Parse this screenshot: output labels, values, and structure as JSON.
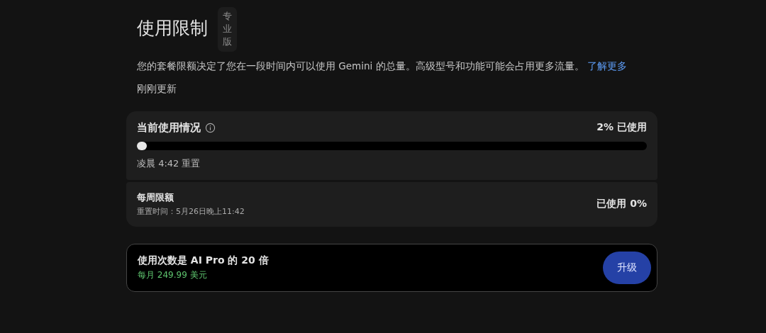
{
  "header": {
    "title": "使用限制",
    "badge": "专业版"
  },
  "description": {
    "text": "您的套餐限额决定了您在一段时间内可以使用 Gemini 的总量。高级型号和功能可能会占用更多流量。",
    "link": "了解更多"
  },
  "updated": "刚刚更新",
  "current_usage": {
    "title": "当前使用情况",
    "reading": "2% 已使用",
    "level": 0.02,
    "reset": "凌晨 4:42 重置"
  },
  "weekly_limit": {
    "title": "每周限额",
    "reset": "重置时间：5月26日晚上11:42",
    "reading": "已使用 0%"
  },
  "upgrade": {
    "title": "使用次数是 AI Pro 的 20 倍",
    "price": "每月 249.99 美元",
    "button": "升级"
  }
}
